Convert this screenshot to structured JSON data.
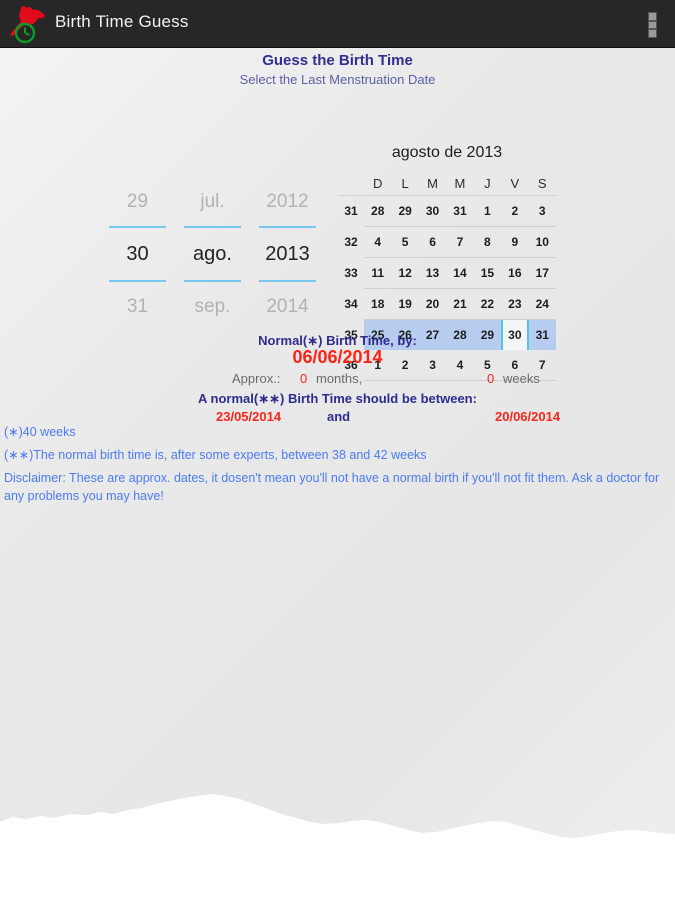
{
  "titlebar": {
    "app_name": "Birth Time Guess",
    "logo_icon": "stork-clock-logo",
    "overflow_icon": "overflow-menu-icon",
    "bg_color": "#272727",
    "text_color": "#f2f2f2"
  },
  "header": {
    "title": "Guess the Birth Time",
    "subtitle": "Select the Last Menstruation Date",
    "title_color": "#312f8f",
    "subtitle_color": "#5c5fa8"
  },
  "date_picker": {
    "accent_color": "#78c7ef",
    "columns": [
      {
        "name": "day",
        "previous": "29",
        "current": "30",
        "next": "31"
      },
      {
        "name": "month",
        "previous": "jul.",
        "current": "ago.",
        "next": "sep."
      },
      {
        "name": "year",
        "previous": "2012",
        "current": "2013",
        "next": "2014"
      }
    ]
  },
  "calendar": {
    "title": "agosto de 2013",
    "weekday_headers": [
      "D",
      "L",
      "M",
      "M",
      "J",
      "V",
      "S"
    ],
    "selected_day": "30",
    "highlight_color": "#b7cdf0",
    "selected_outline_color": "#4fc3e8",
    "weeks": [
      {
        "number": "31",
        "days": [
          {
            "label": "28",
            "state": "prev"
          },
          {
            "label": "29",
            "state": "prev"
          },
          {
            "label": "30",
            "state": "prev"
          },
          {
            "label": "31",
            "state": "prev"
          },
          {
            "label": "1",
            "state": "current"
          },
          {
            "label": "2",
            "state": "current"
          },
          {
            "label": "3",
            "state": "current"
          }
        ]
      },
      {
        "number": "32",
        "days": [
          {
            "label": "4",
            "state": "current"
          },
          {
            "label": "5",
            "state": "current"
          },
          {
            "label": "6",
            "state": "current"
          },
          {
            "label": "7",
            "state": "current"
          },
          {
            "label": "8",
            "state": "current"
          },
          {
            "label": "9",
            "state": "current"
          },
          {
            "label": "10",
            "state": "current"
          }
        ]
      },
      {
        "number": "33",
        "days": [
          {
            "label": "11",
            "state": "current"
          },
          {
            "label": "12",
            "state": "current"
          },
          {
            "label": "13",
            "state": "current"
          },
          {
            "label": "14",
            "state": "current"
          },
          {
            "label": "15",
            "state": "current"
          },
          {
            "label": "16",
            "state": "current"
          },
          {
            "label": "17",
            "state": "current"
          }
        ]
      },
      {
        "number": "34",
        "days": [
          {
            "label": "18",
            "state": "current"
          },
          {
            "label": "19",
            "state": "current"
          },
          {
            "label": "20",
            "state": "current"
          },
          {
            "label": "21",
            "state": "current"
          },
          {
            "label": "22",
            "state": "current"
          },
          {
            "label": "23",
            "state": "current"
          },
          {
            "label": "24",
            "state": "current"
          }
        ]
      },
      {
        "number": "35",
        "selected_week": true,
        "days": [
          {
            "label": "25",
            "state": "current"
          },
          {
            "label": "26",
            "state": "current"
          },
          {
            "label": "27",
            "state": "current"
          },
          {
            "label": "28",
            "state": "current"
          },
          {
            "label": "29",
            "state": "current"
          },
          {
            "label": "30",
            "state": "selected"
          },
          {
            "label": "31",
            "state": "current"
          }
        ]
      },
      {
        "number": "36",
        "days": [
          {
            "label": "1",
            "state": "next"
          },
          {
            "label": "2",
            "state": "next"
          },
          {
            "label": "3",
            "state": "next"
          },
          {
            "label": "4",
            "state": "next"
          },
          {
            "label": "5",
            "state": "next"
          },
          {
            "label": "6",
            "state": "next"
          },
          {
            "label": "7",
            "state": "next"
          }
        ]
      }
    ]
  },
  "result": {
    "normal_label": "Normal(∗) Birth Time, by:",
    "normal_date": "06/06/2014",
    "approx_label": "Approx.:",
    "approx_months_value": "0",
    "approx_months_unit": "months,",
    "approx_weeks_value": "0",
    "approx_weeks_unit": "weeks",
    "between_label": "A normal(∗∗) Birth Time should be between:",
    "range_start": "23/05/2014",
    "range_conjunction": "and",
    "range_end": "20/06/2014",
    "blue_color": "#2e2b8e",
    "red_color": "#ff2418"
  },
  "notes": {
    "note_one": "(∗)40 weeks",
    "note_two": "(∗∗)The normal birth time is, after some experts, between 38 and 42 weeks",
    "disclaimer": "Disclaimer: These are approx. dates, it dosen't mean you'll not have a normal birth if you'll not fit them. Ask a doctor for any problems you may have!",
    "color": "#4a7bf7"
  }
}
